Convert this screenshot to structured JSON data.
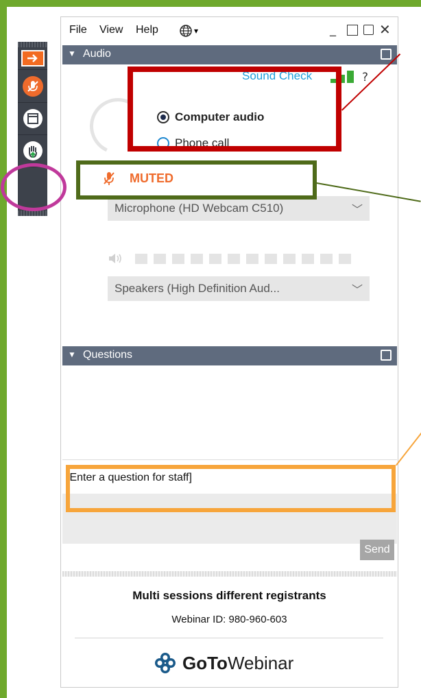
{
  "menu": {
    "file": "File",
    "view": "View",
    "help": "Help"
  },
  "audio": {
    "header": "Audio",
    "sound_check": "Sound Check",
    "help_mark": "?",
    "options": [
      "Computer audio",
      "Phone call"
    ],
    "selected_option": "Computer audio",
    "muted_label": "MUTED",
    "microphone": "Microphone (HD Webcam C510)",
    "speakers": "Speakers (High Definition Aud..."
  },
  "questions": {
    "header": "Questions",
    "input_placeholder": "[Enter a question for staff]",
    "send_label": "Send"
  },
  "footer": {
    "session_title": "Multi sessions different registrants",
    "webinar_id": "Webinar ID: 980-960-603",
    "brand_bold": "GoTo",
    "brand_regular": "Webinar"
  },
  "colors": {
    "page_background": "#6fa92d",
    "header_bar": "#5f6b7e",
    "muted_orange": "#ef6b2c",
    "sound_check_blue": "#1fa0db",
    "annotation_red": "#c00000",
    "annotation_olive": "#4f6b1a",
    "annotation_orange": "#f7a53b",
    "annotation_magenta": "#c0399b"
  },
  "icons": [
    "arrow-right-icon",
    "mic-muted-icon",
    "window-icon",
    "raise-hand-icon",
    "globe-icon",
    "speaker-icon",
    "chevron-down-icon",
    "gotowebinar-logo-icon"
  ]
}
